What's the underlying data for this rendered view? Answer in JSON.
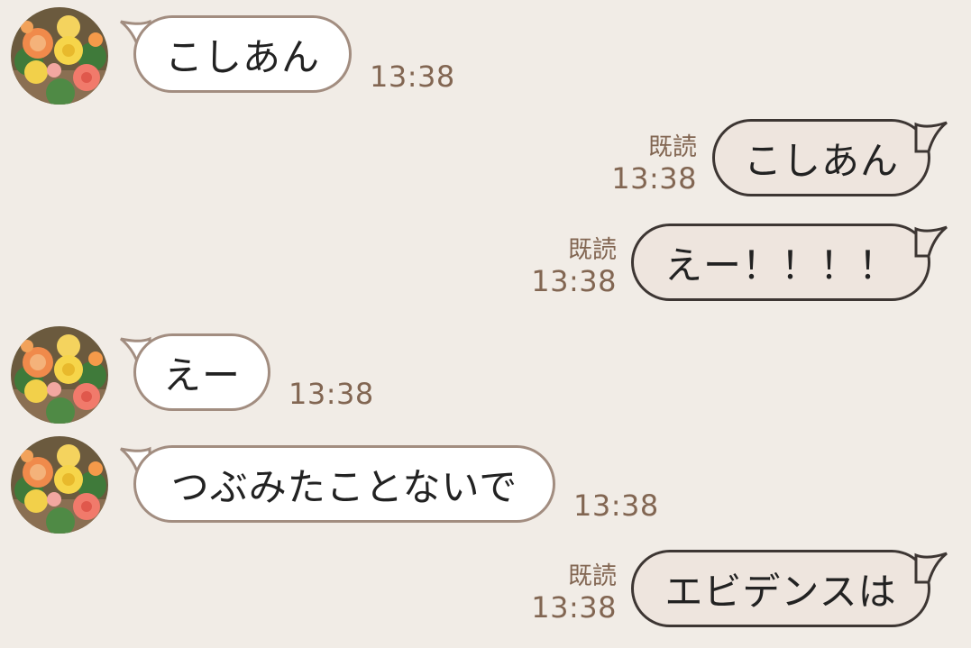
{
  "messages": [
    {
      "direction": "incoming",
      "text": "こしあん",
      "time": "13:38"
    },
    {
      "direction": "outgoing",
      "text": "こしあん",
      "time": "13:38",
      "read": "既読"
    },
    {
      "direction": "outgoing",
      "text": "えー！！！！",
      "time": "13:38",
      "read": "既読"
    },
    {
      "direction": "incoming",
      "text": "えー",
      "time": "13:38"
    },
    {
      "direction": "incoming",
      "text": "つぶみたことないで",
      "time": "13:38"
    },
    {
      "direction": "outgoing",
      "text": "エビデンスは",
      "time": "13:38",
      "read": "既読"
    }
  ],
  "avatar": {
    "icon": "flower-bouquet-avatar"
  },
  "colors": {
    "background": "#f1ece6",
    "incoming_bubble": "#ffffff",
    "incoming_border": "#a28d80",
    "outgoing_bubble": "#eee5de",
    "outgoing_border": "#3d3633",
    "meta_text": "#826652"
  }
}
